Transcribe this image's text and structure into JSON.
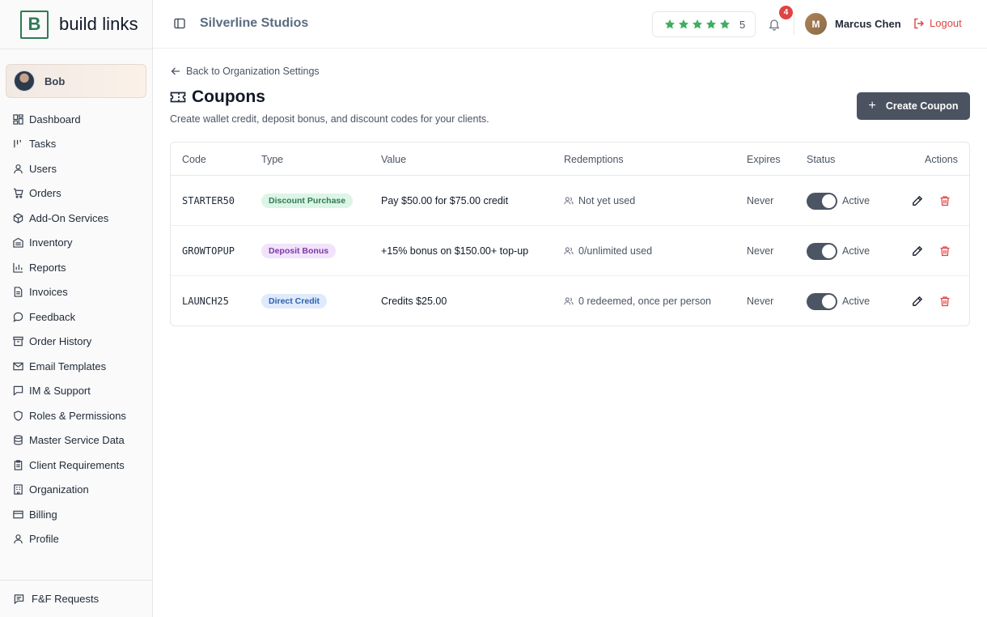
{
  "brand": {
    "mark": "B",
    "name": "build links"
  },
  "sidebar": {
    "user": {
      "name": "Bob"
    },
    "items": [
      {
        "label": "Dashboard",
        "icon": "dashboard-icon"
      },
      {
        "label": "Tasks",
        "icon": "tasks-icon"
      },
      {
        "label": "Users",
        "icon": "user-icon"
      },
      {
        "label": "Orders",
        "icon": "cart-icon"
      },
      {
        "label": "Add-On Services",
        "icon": "package-icon"
      },
      {
        "label": "Inventory",
        "icon": "inventory-icon"
      },
      {
        "label": "Reports",
        "icon": "bar-chart-icon"
      },
      {
        "label": "Invoices",
        "icon": "invoice-icon"
      },
      {
        "label": "Feedback",
        "icon": "chat-icon"
      },
      {
        "label": "Order History",
        "icon": "archive-icon"
      },
      {
        "label": "Email Templates",
        "icon": "mail-icon"
      },
      {
        "label": "IM & Support",
        "icon": "message-icon"
      },
      {
        "label": "Roles & Permissions",
        "icon": "shield-icon"
      },
      {
        "label": "Master Service Data",
        "icon": "database-icon"
      },
      {
        "label": "Client Requirements",
        "icon": "clipboard-icon"
      },
      {
        "label": "Organization",
        "icon": "building-icon"
      },
      {
        "label": "Billing",
        "icon": "credit-card-icon"
      },
      {
        "label": "Profile",
        "icon": "user-icon"
      }
    ],
    "footer": {
      "label": "F&F Requests",
      "icon": "message-square-icon"
    }
  },
  "header": {
    "org_name": "Silverline Studios",
    "rating": {
      "stars": 5,
      "value": "5"
    },
    "notifications": {
      "count": "4"
    },
    "user": {
      "initial": "M",
      "name": "Marcus Chen"
    },
    "logout_label": "Logout"
  },
  "main": {
    "back_label": "Back to Organization Settings",
    "title": "Coupons",
    "subtitle": "Create wallet credit, deposit bonus, and discount codes for your clients.",
    "create_label": "Create Coupon",
    "columns": [
      "Code",
      "Type",
      "Value",
      "Redemptions",
      "Expires",
      "Status",
      "Actions"
    ],
    "rows": [
      {
        "code": "STARTER50",
        "type": "Discount Purchase",
        "value": "Pay $50.00 for $75.00 credit",
        "redemptions": "Not yet used",
        "expires": "Never",
        "status": "Active"
      },
      {
        "code": "GROWTOPUP",
        "type": "Deposit Bonus",
        "value": "+15% bonus on $150.00+ top-up",
        "redemptions": "0/unlimited used",
        "expires": "Never",
        "status": "Active"
      },
      {
        "code": "LAUNCH25",
        "type": "Direct Credit",
        "value": "Credits $25.00",
        "redemptions": "0 redeemed, once per person",
        "expires": "Never",
        "status": "Active"
      }
    ]
  },
  "colors": {
    "brand_green": "#2f7a55",
    "star_green": "#3fae5f",
    "danger": "#e04343",
    "primary_button": "#4b5260",
    "badge_discount_bg": "#dcf5e6",
    "badge_discount_fg": "#2f7a55",
    "badge_deposit_bg": "#f1e3fb",
    "badge_deposit_fg": "#7b3aa6",
    "badge_credit_bg": "#dfeafc",
    "badge_credit_fg": "#2f5fa8"
  }
}
